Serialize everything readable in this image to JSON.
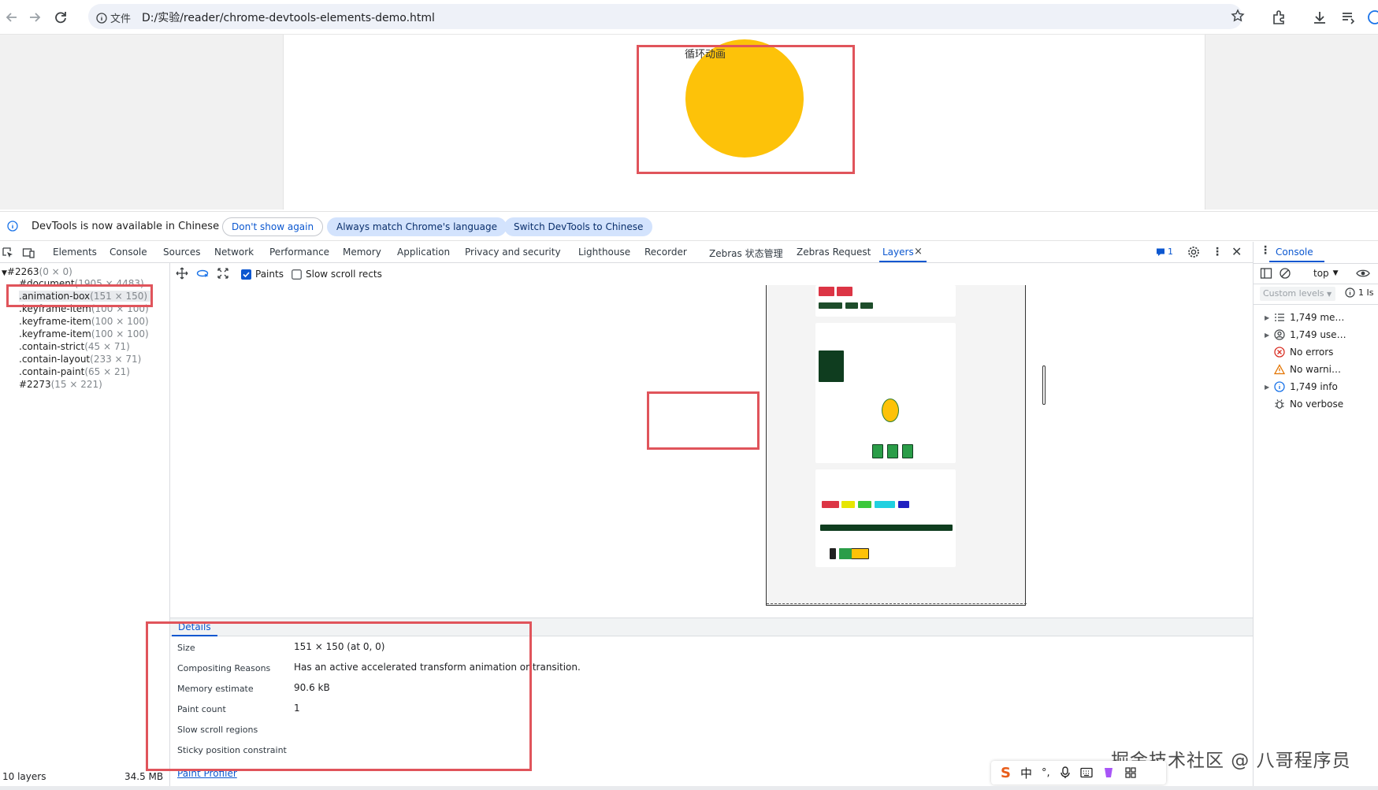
{
  "browser": {
    "url_prefix": "文件",
    "url": "D:/实验/reader/chrome-devtools-elements-demo.html"
  },
  "page": {
    "animation_title": "循环动画",
    "circle_color": "#fdc209"
  },
  "infobar": {
    "message": "DevTools is now available in Chinese",
    "btn_dont_show": "Don't show again",
    "btn_match": "Always match Chrome's language",
    "btn_switch": "Switch DevTools to Chinese"
  },
  "tabs": [
    "Elements",
    "Console",
    "Sources",
    "Network",
    "Performance",
    "Memory",
    "Application",
    "Privacy and security",
    "Lighthouse",
    "Recorder",
    "Zebras 状态管理",
    "Zebras Request",
    "Layers"
  ],
  "tab_badge": "1",
  "console_tab": "Console",
  "layers_toolbar": {
    "paints": "Paints",
    "slow_scroll": "Slow scroll rects"
  },
  "tree": [
    {
      "name": "#2263",
      "size": "(0 × 0)"
    },
    {
      "name": "#document",
      "size": "(1905 × 4483)"
    },
    {
      "name": ".animation-box",
      "size": "(151 × 150)"
    },
    {
      "name": ".keyframe-item",
      "size": "(100 × 100)"
    },
    {
      "name": ".keyframe-item",
      "size": "(100 × 100)"
    },
    {
      "name": ".keyframe-item",
      "size": "(100 × 100)"
    },
    {
      "name": ".contain-strict",
      "size": "(45 × 71)"
    },
    {
      "name": ".contain-layout",
      "size": "(233 × 71)"
    },
    {
      "name": ".contain-paint",
      "size": "(65 × 21)"
    },
    {
      "name": "#2273",
      "size": "(15 × 221)"
    }
  ],
  "layers_footer": {
    "count": "10 layers",
    "memory": "34.5 MB"
  },
  "details": {
    "tab": "Details",
    "rows": [
      {
        "label": "Size",
        "value": "151 × 150 (at 0, 0)"
      },
      {
        "label": "Compositing Reasons",
        "value": "Has an active accelerated transform animation or transition."
      },
      {
        "label": "Memory estimate",
        "value": "90.6 kB"
      },
      {
        "label": "Paint count",
        "value": "1"
      },
      {
        "label": "Slow scroll regions",
        "value": ""
      },
      {
        "label": "Sticky position constraint",
        "value": ""
      }
    ],
    "paint_profiler": "Paint Profiler"
  },
  "console": {
    "context": "top",
    "levels": "Custom levels",
    "badge": "1 Is",
    "items": [
      {
        "label": "1,749 me…",
        "icon": "list-icon"
      },
      {
        "label": "1,749 use…",
        "icon": "user-icon"
      },
      {
        "label": "No errors",
        "icon": "error-icon"
      },
      {
        "label": "No warni…",
        "icon": "warning-icon"
      },
      {
        "label": "1,749 info",
        "icon": "info-icon"
      },
      {
        "label": "No verbose",
        "icon": "bug-icon"
      }
    ]
  },
  "watermark": "掘金技术社区 @ 八哥程序员",
  "ime": {
    "lang": "中"
  },
  "colors": {
    "highlight": "#e0545b",
    "accent": "#0b57d0"
  }
}
